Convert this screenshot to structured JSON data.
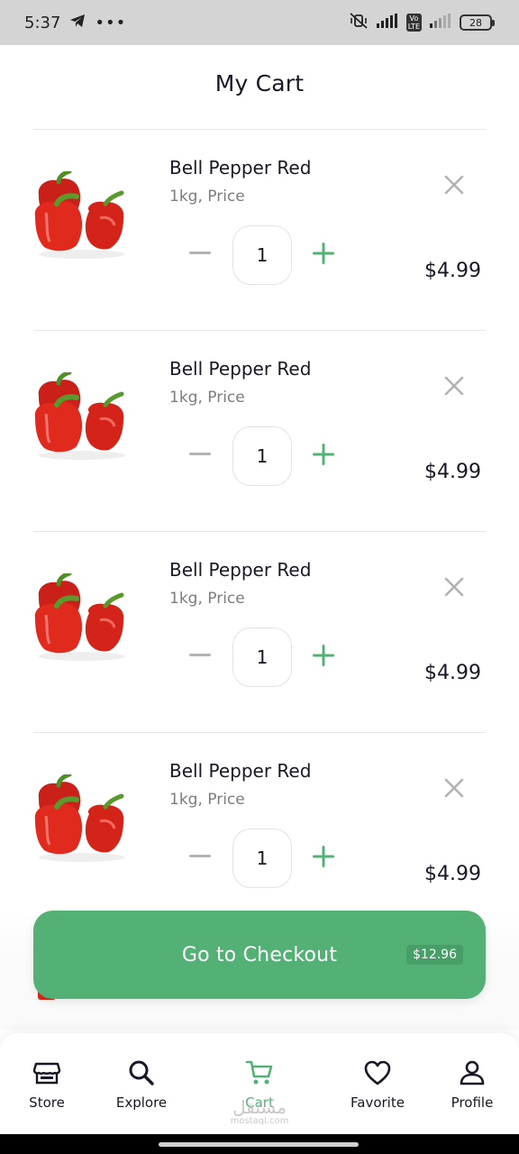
{
  "status_bar": {
    "time": "5:37",
    "battery": "28",
    "volte_top": "Vo",
    "volte_bottom": "LTE"
  },
  "header": {
    "title": "My Cart"
  },
  "cart": {
    "items": [
      {
        "name": "Bell Pepper Red",
        "desc": "1kg, Price",
        "qty": "1",
        "price": "$4.99",
        "icon": "bell-pepper-image"
      },
      {
        "name": "Bell Pepper Red",
        "desc": "1kg, Price",
        "qty": "1",
        "price": "$4.99",
        "icon": "bell-pepper-image"
      },
      {
        "name": "Bell Pepper Red",
        "desc": "1kg, Price",
        "qty": "1",
        "price": "$4.99",
        "icon": "bell-pepper-image"
      },
      {
        "name": "Bell Pepper Red",
        "desc": "1kg, Price",
        "qty": "1",
        "price": "$4.99",
        "icon": "bell-pepper-image"
      }
    ]
  },
  "checkout": {
    "label": "Go to Checkout",
    "total": "$12.96"
  },
  "nav": {
    "items": [
      {
        "label": "Store",
        "icon": "store-icon",
        "active": false
      },
      {
        "label": "Explore",
        "icon": "search-icon",
        "active": false
      },
      {
        "label": "Cart",
        "icon": "cart-icon",
        "active": true
      },
      {
        "label": "Favorite",
        "icon": "heart-icon",
        "active": false
      },
      {
        "label": "Profile",
        "icon": "person-icon",
        "active": false
      }
    ]
  },
  "watermark": {
    "arabic": "مستقل",
    "latin": "mostaql.com"
  },
  "colors": {
    "accent": "#53b175",
    "text": "#181725",
    "muted": "#7c7c7c",
    "divider": "#e6e6e6"
  }
}
